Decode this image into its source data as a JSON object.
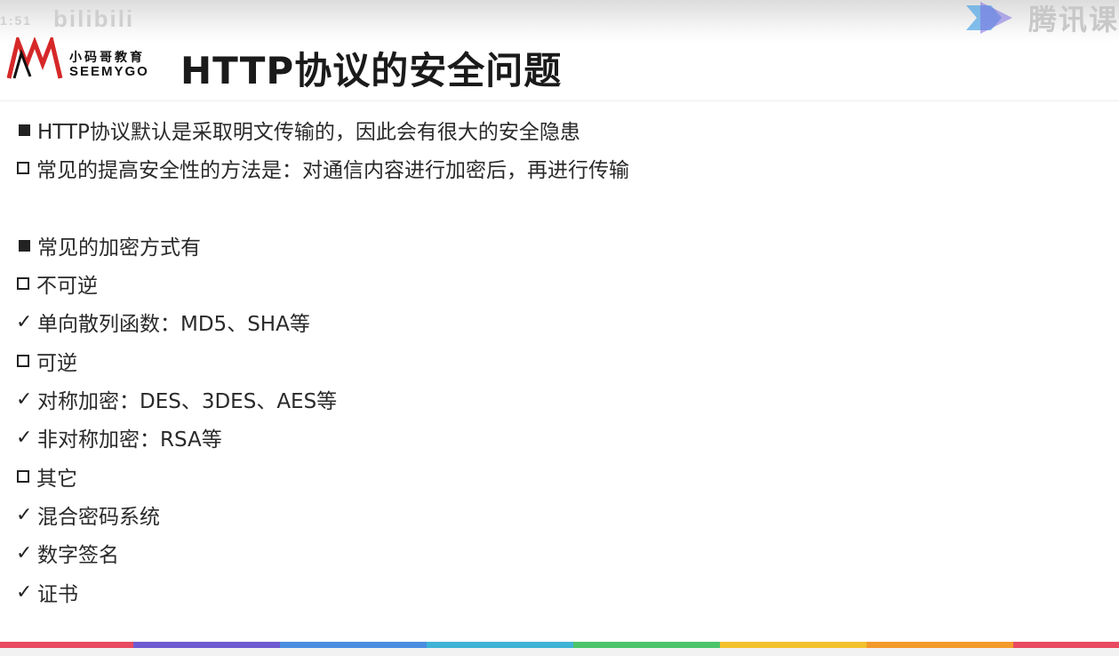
{
  "watermark": {
    "left_small": "1:51",
    "left_text": "bilibili",
    "right_text": "腾讯课",
    "right_icon": "play-icon"
  },
  "logo": {
    "cn": "小码哥教育",
    "en": "SEEMYGO",
    "mark_color": "#d62828"
  },
  "title": "HTTP协议的安全问题",
  "bullets": [
    {
      "marker": "filled-square",
      "text": "HTTP协议默认是采取明文传输的，因此会有很大的安全隐患"
    },
    {
      "marker": "hollow-square",
      "text": "常见的提高安全性的方法是：对通信内容进行加密后，再进行传输"
    },
    {
      "marker": "filled-square",
      "text": "常见的加密方式有"
    },
    {
      "marker": "hollow-square",
      "text": "不可逆"
    },
    {
      "marker": "check",
      "text": "单向散列函数：MD5、SHA等"
    },
    {
      "marker": "hollow-square",
      "text": "可逆"
    },
    {
      "marker": "check",
      "text": "对称加密：DES、3DES、AES等"
    },
    {
      "marker": "check",
      "text": "非对称加密：RSA等"
    },
    {
      "marker": "hollow-square",
      "text": "其它"
    },
    {
      "marker": "check",
      "text": "混合密码系统"
    },
    {
      "marker": "check",
      "text": "数字签名"
    },
    {
      "marker": "check",
      "text": "证书"
    }
  ],
  "check_glyph": "✓",
  "colors": {
    "bar": [
      "#e84a5f",
      "#6e5bd1",
      "#4a8de0",
      "#3fb3d6",
      "#4cc46a",
      "#f2c12e",
      "#f39a2b",
      "#e84a5f"
    ]
  }
}
